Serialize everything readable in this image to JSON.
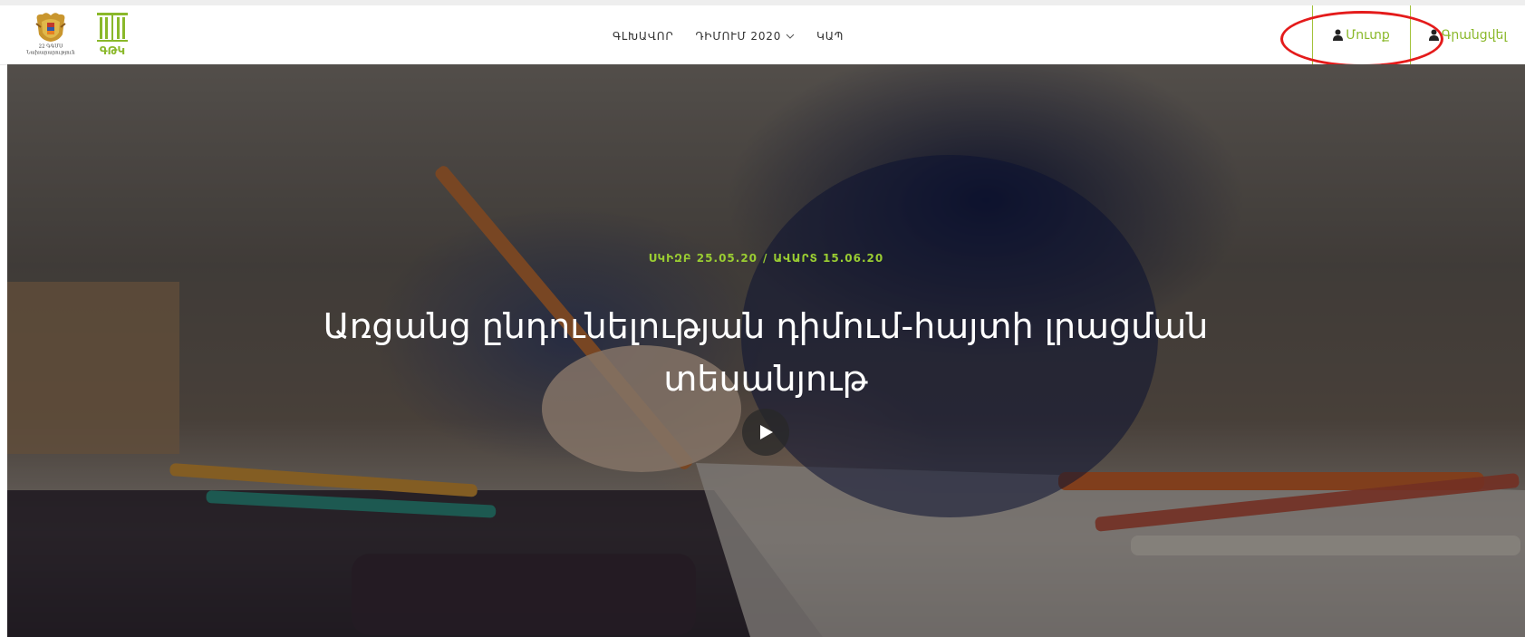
{
  "header": {
    "emblem_caption_line1": "22 ԳԳՄՍ",
    "emblem_caption_line2": "Նախարարություն",
    "logo2_text": "ԳԹԿ",
    "nav": [
      {
        "label": "ԳԼԽԱՎՈՐ",
        "icon": null
      },
      {
        "label": "ԴԻՄՈՒՄ 2020",
        "icon": "chevron-down-icon"
      },
      {
        "label": "ԿԱՊ",
        "icon": null
      }
    ],
    "login_label": "Մուտք",
    "register_label": "Գրանցվել",
    "accent_color": "#8ab82a"
  },
  "hero": {
    "start_label": "ՍԿԻԶԲ 25.05.20",
    "separator": "/",
    "end_label": "ԱՎԱՐՏ 15.06.20",
    "title_line1": "Առցանց ընդունելության դիմում-հայտի լրացման",
    "title_line2": "տեսանյութ",
    "play_icon": "play-icon"
  },
  "annotation": {
    "color": "#e41b1b",
    "target": "login-button"
  }
}
